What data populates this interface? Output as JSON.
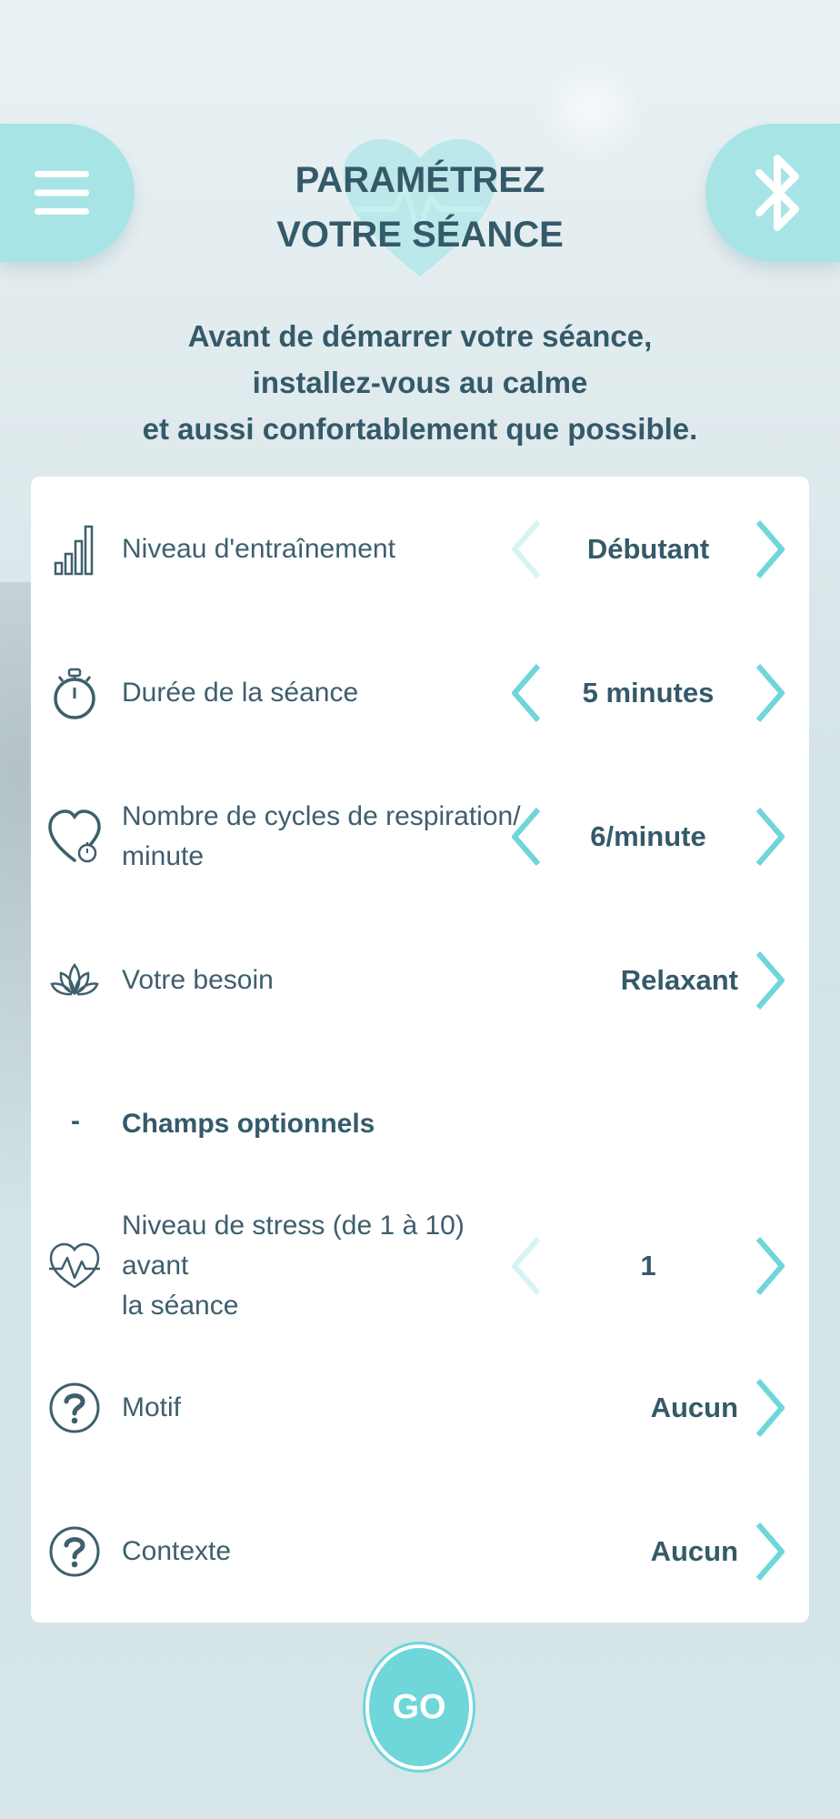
{
  "header": {
    "title_line1": "PARAMÉTREZ",
    "title_line2": "VOTRE SÉANCE",
    "menu_icon": "hamburger-menu-icon",
    "bluetooth_icon": "bluetooth-icon",
    "logo_icon": "heart-pulse-logo"
  },
  "intro": {
    "line1": "Avant de démarrer votre séance,",
    "line2": "installez-vous au calme",
    "line3": "et aussi confortablement que possible."
  },
  "settings": {
    "training_level": {
      "label": "Niveau d'entraînement",
      "value": "Débutant",
      "icon": "signal-bars-icon",
      "prev_enabled": false,
      "next_enabled": true
    },
    "duration": {
      "label": "Durée de la séance",
      "value": "5 minutes",
      "icon": "stopwatch-icon",
      "prev_enabled": true,
      "next_enabled": true
    },
    "breathing_cycles": {
      "label_line1": "Nombre de cycles de respiration/",
      "label_line2": "minute",
      "value": "6/minute",
      "icon": "heart-timer-icon",
      "prev_enabled": true,
      "next_enabled": true
    },
    "need": {
      "label": "Votre besoin",
      "value": "Relaxant",
      "icon": "lotus-icon"
    },
    "optional_section": {
      "dash": "-",
      "label": "Champs optionnels"
    },
    "stress_level": {
      "label_line1": "Niveau de stress (de 1 à 10) avant",
      "label_line2": "la séance",
      "value": "1",
      "icon": "heart-pulse-icon",
      "prev_enabled": false,
      "next_enabled": true
    },
    "motive": {
      "label": "Motif",
      "value": "Aucun",
      "icon": "question-icon"
    },
    "context": {
      "label": "Contexte",
      "value": "Aucun",
      "icon": "question-icon"
    }
  },
  "go_button": {
    "label": "GO"
  },
  "colors": {
    "accent": "#6fd6da",
    "accent_light": "#a7e4e6",
    "text_dark": "#345a6a",
    "arrow_active": "#6fd6da",
    "arrow_disabled": "#d8f3f4"
  }
}
